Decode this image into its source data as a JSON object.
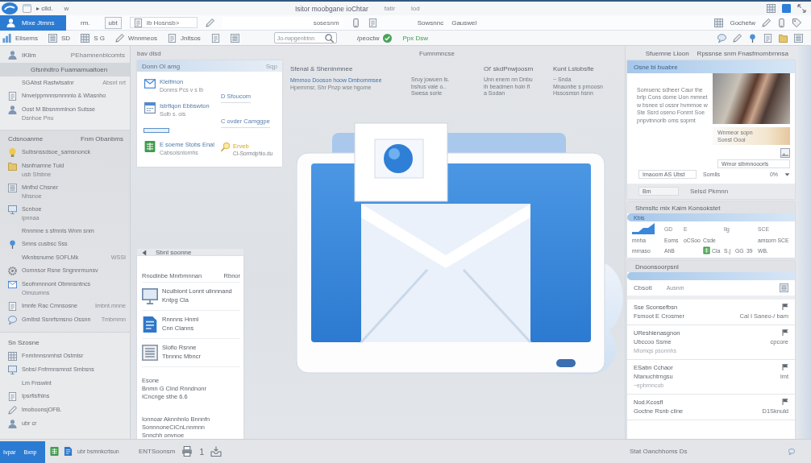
{
  "title_bar": {
    "app_label": "▸ clld.",
    "menu_label": "w",
    "title": "Isitor moobgane ioChtar",
    "items": [
      "fatir",
      "lod"
    ]
  },
  "ribbon": {
    "tabs": [
      {
        "label": "Mixe Jtmns",
        "selected": true
      },
      {
        "label": "rm.",
        "selected": false
      }
    ],
    "button": "ubt",
    "fields": [
      {
        "value": "Ib Hosnsb>"
      },
      {
        "value": "sosesnm"
      }
    ],
    "links": [
      "Sowsnnc",
      "Gauswel"
    ],
    "right_label": "Gochetw"
  },
  "toolbar": {
    "groups": [
      "Elisems",
      "SD",
      "S G",
      "Wnnmeos",
      "Jnltsos"
    ],
    "search": {
      "placeholder": "Jo-rwpgenbtnn"
    },
    "actions": [
      "/peoctw",
      "Ppx Dsw"
    ]
  },
  "sidebar": {
    "title": "IKlim",
    "subtitle": "PEhamnenblcomts",
    "groups": [
      {
        "title": "Gfsnhdtro Fuamamuaitoen",
        "selected": true,
        "items": [
          {
            "kind": "plain",
            "label": "SGAbst Rasfwtsatnr",
            "aside": "Absnt nrt"
          },
          {
            "kind": "icon",
            "label": "Nnvelppmnnsmnnnlo & Wlasnho"
          },
          {
            "kind": "icon",
            "label": "Oost M Bbsnmmlnon Sutsse",
            "sub": "Dsnhoe Pnu"
          }
        ]
      },
      {
        "title": "Cdsnoanme",
        "aside": "Fnm Obanbms",
        "selected": false,
        "items": [
          {
            "kind": "icon",
            "label": "Sulbsnssdsoe_samsnonck"
          },
          {
            "kind": "icon",
            "label": "Nsnfnamne Tuid",
            "sub": "usb Sfnbne"
          },
          {
            "kind": "icon",
            "label": "Mnfhd Chsner",
            "sub": "Nhsnoe"
          },
          {
            "kind": "icon",
            "label": "Scnhoe",
            "sub": "ipnnaa"
          },
          {
            "kind": "plain",
            "label": "Rnnmne s sfmnls Wnm snm"
          },
          {
            "kind": "icon",
            "label": "Smns cusbsc Sss"
          },
          {
            "kind": "plain",
            "label": "Wknbsnume SOFLMk",
            "aside": "WSSI"
          },
          {
            "kind": "icon",
            "label": "Oomnsor Rsne Sngnnrmunsv"
          },
          {
            "kind": "icon",
            "label": "Seofnmnnont Obmnsntncs",
            "sub": "Oimzumns"
          },
          {
            "kind": "icon",
            "label": "Imnfe Rac Cmnsosne",
            "aside": "Imbnt.mnne"
          },
          {
            "kind": "icon",
            "label": "Gmlbst Ssnrfsmsno Ossnn",
            "aside": "Tmbmmn"
          }
        ]
      },
      {
        "title": "Sn Szosne",
        "selected": false,
        "items": [
          {
            "kind": "icon",
            "label": "Fnmhnnsnmhst Ostmlsr"
          },
          {
            "kind": "icon",
            "label": "Snbsl Fnfrmnsmnst Smbsns"
          },
          {
            "kind": "plain",
            "label": "Lm Fnswlnt"
          },
          {
            "kind": "icon",
            "label": "Ipsrfisfhlns"
          },
          {
            "kind": "icon",
            "label": "lmoboonsjOFB."
          },
          {
            "kind": "icon",
            "label": "ubr cr"
          }
        ]
      }
    ]
  },
  "center": {
    "header_left": "bav dlsd",
    "header_right": "Fumnmncse",
    "quick_card": {
      "title": "Donn Ol amg",
      "aside": "Sqp",
      "items": [
        {
          "label": "Kleifmon",
          "sub": "Donms Pcs v s lb"
        },
        {
          "label": "Istrfiqon Ebbswton",
          "sub": "Sulb s. ois"
        },
        {
          "label": "E soeme Stobs Enal",
          "sub": "Cabsoisnlomhs"
        }
      ],
      "links": [
        {
          "label": "D Sfoucom"
        },
        {
          "label": "C ovder Camggpe"
        },
        {
          "label": "Erveb",
          "sub": "CI-Sormdphlo.du"
        }
      ]
    },
    "info": {
      "title": "Sfenal & Sheninmnee",
      "link": "Mmmoo Dooson hoow Dmbommsee",
      "text": "Hpemmsr, Shr Pnzp wse hgome"
    },
    "columns": [
      {
        "lines": [
          "Sruy jowuen ls.",
          "bshus vaie o..",
          "Swesa sorie"
        ]
      },
      {
        "title": "Ol' skdPnwjoosrn",
        "lines": [
          "Unn enem nn Dnbu",
          "ih beadmen hoin fl",
          "a Sodan"
        ]
      },
      {
        "title": "Kunt Lstobsfle",
        "lines": [
          "~ Snda",
          "Mnaonbe s prnoosn",
          "Hssosmsn hsnn"
        ]
      }
    ],
    "panel": {
      "title": "Sbnl soonne",
      "subtitle": "Rnodinbe Mnrbmnnan",
      "aside": "Rbnor",
      "items": [
        {
          "label": "Nculbiont Lonnt ulinnnand",
          "sub": "Kntpg Cla"
        },
        {
          "label": "Rnnnns Hnml",
          "sub": "Cnn Clanns"
        },
        {
          "label": "Sloflo Rsnne",
          "sub": "Tbnnnc Mbncr"
        }
      ],
      "notes": [
        "Esone",
        "Bnmn G Clnd Rnndnonr",
        "ICncnge sthe 6.6"
      ],
      "footer": [
        "Ionnoar Aknnhnlo Bnnnfn",
        "SonnnoneCiCnLnnmnn",
        "Snnchh onvnoe"
      ]
    }
  },
  "right_panel": {
    "header": "Sfuemne Lloon",
    "header_aside": "Rpssnse snm Fnasfmornbrnnsa",
    "band": "Osne bi buabre",
    "paragraph": "Somuenc sdheer Caur the brlp Cons dome Uon mmnet w bsnee sl ossnr hvmmoe w Ste Ssrd oseno Fonmt Soe pnpvtnnorlb oms sopmt",
    "promo": [
      "Wnmeor sopn",
      "Sonst Oooi"
    ],
    "field": "Wmor slbmnooorls",
    "row": {
      "field": "Imaoom AS Ubst",
      "label": "Somlls",
      "value": "0%"
    },
    "filter": {
      "field": "Bm",
      "label": "Selsd Pkmnn"
    },
    "stats": {
      "title": "Shmsltc mix Kaim Konsokstet",
      "band": "Kbis",
      "rows": [
        [
          null,
          {
            "kind": "header",
            "text": "GD"
          },
          {
            "kind": "header",
            "text": "E"
          },
          null,
          {
            "kind": "header",
            "text": "llg"
          },
          null,
          null,
          {
            "kind": "header",
            "text": "SCE"
          }
        ],
        [
          {
            "kind": "text",
            "text": "mnha"
          },
          {
            "kind": "text",
            "text": "Eoms"
          },
          {
            "kind": "text",
            "text": "oCSoo"
          },
          {
            "kind": "text",
            "text": "Csde"
          },
          null,
          null,
          null,
          {
            "kind": "text",
            "text": "amsorn SCE"
          }
        ],
        [
          {
            "kind": "text",
            "text": "mrnaso"
          },
          {
            "kind": "text",
            "text": "AhB"
          },
          null,
          {
            "kind": "icon",
            "text": "Cla"
          },
          {
            "kind": "text",
            "text": "S.j"
          },
          {
            "kind": "text",
            "text": "GG"
          },
          {
            "kind": "text",
            "text": "39"
          },
          {
            "kind": "text",
            "text": "WB."
          }
        ]
      ]
    },
    "mail": {
      "title": "Dnoonsoorpsnl",
      "filter": {
        "label": "Cbsotl",
        "value": "Ausnm"
      },
      "messages": [
        {
          "sender": "Sse Sconsefbsn",
          "subject": "Fsmoot E Crosmer",
          "meta": "Cal I Saneo-/ bam"
        },
        {
          "sender": "UReshlenasgnon",
          "subject": "Ubccoo Ssme",
          "preview": "Mlomqs psonnhs",
          "meta": "cpcore"
        },
        {
          "sender": "ESabn Cchaor",
          "subject": "Ntanuchtrngsu",
          "preview": "~ephrnncob",
          "meta": "lmt"
        },
        {
          "sender": "Nod.Kcosfl",
          "subject": "Goctne Rsnb cline",
          "meta": "D1Sknuld"
        }
      ]
    }
  },
  "status_bar": {
    "start": [
      "Ivpar",
      "Bxnp"
    ],
    "task_label": "ubr bsmnkcrtsun",
    "panel_label": "ENTSoonsm",
    "panel_count": "1",
    "right_label": "Stat Oanchhoms Ds"
  }
}
